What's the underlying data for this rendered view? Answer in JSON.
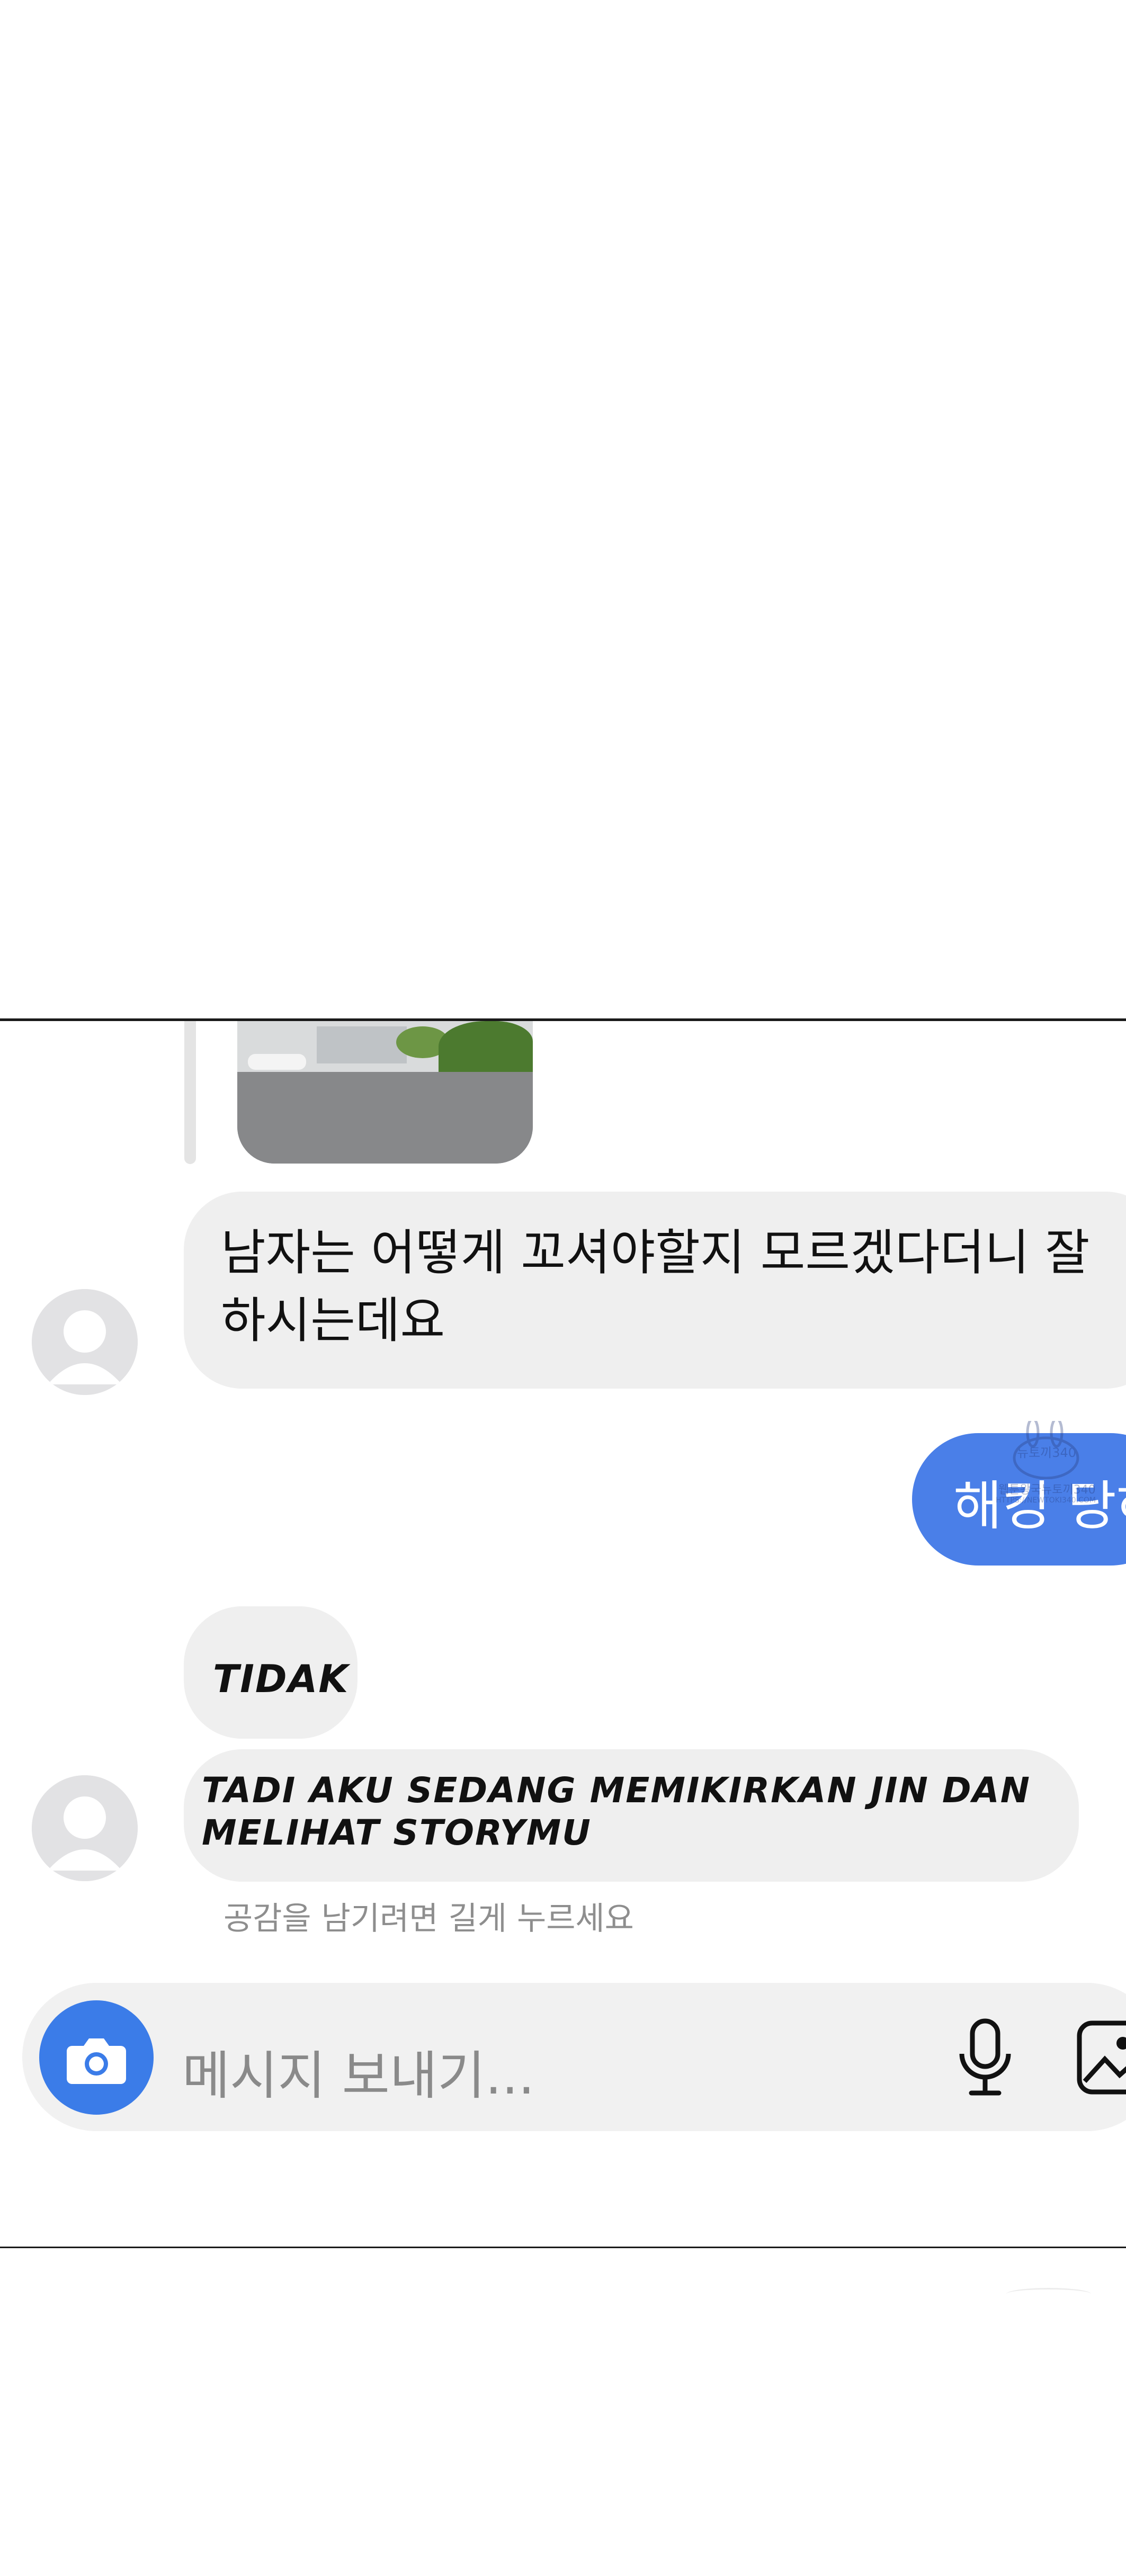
{
  "conversation": {
    "message_1": "남자는 어떻게 꼬셔야할지 모르겠다더니 잘\n하시는데요",
    "message_sent": "해킹 당하",
    "message_2": "TIDAK",
    "message_3": "TADI AKU SEDANG MEMIKIRKAN JIN DAN\nMELIHAT STORYMU",
    "reaction_hint": "공감을 남기려면 길게 누르세요"
  },
  "watermark": {
    "line1": "뉴토끼340",
    "line2": "웹툰왕국뉴토끼340",
    "line3": "HTTPS://NEWTOKI340.COM"
  },
  "composer": {
    "placeholder": "메시지 보내기..."
  },
  "icons": {
    "camera": "camera-icon",
    "mic": "microphone-icon",
    "gallery": "image-gallery-icon",
    "avatar": "default-profile-icon"
  },
  "colors": {
    "sent_bubble": "#4a7fe8",
    "received_bubble": "#efefef",
    "camera_button": "#3b7ce8",
    "hint_text": "#8e8e8e"
  }
}
